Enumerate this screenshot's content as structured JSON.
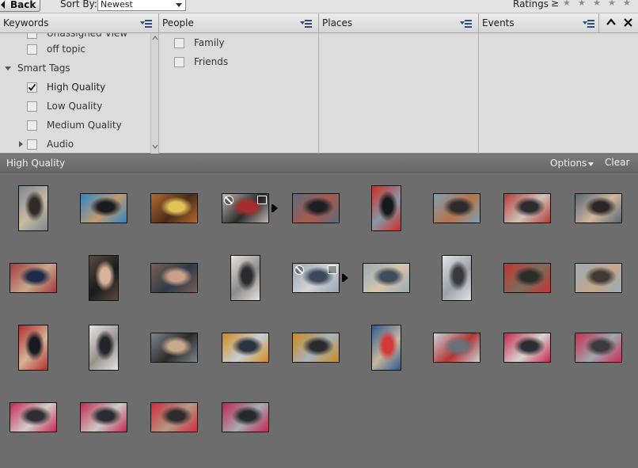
{
  "toolbar": {
    "back_label": "Back",
    "sort_label": "Sort By:",
    "sort_value": "Newest",
    "ratings_label": "Ratings",
    "ratings_compare": "≥",
    "stars": [
      "★",
      "★",
      "★",
      "★",
      "★"
    ]
  },
  "columns": {
    "keywords": "Keywords",
    "people": "People",
    "places": "Places",
    "events": "Events"
  },
  "keywords_list": [
    {
      "label": "Unassigned View",
      "checked": false,
      "clipped": true
    },
    {
      "label": "off topic",
      "checked": false
    },
    {
      "label": "Smart Tags",
      "is_group": true,
      "expanded": true
    },
    {
      "label": "High Quality",
      "checked": true
    },
    {
      "label": "Low Quality",
      "checked": false
    },
    {
      "label": "Medium Quality",
      "checked": false
    },
    {
      "label": "Audio",
      "checked": false,
      "collapsed_group": true
    }
  ],
  "people_list": [
    {
      "label": "Family",
      "checked": false
    },
    {
      "label": "Friends",
      "checked": false
    }
  ],
  "filter_bar": {
    "title": "High Quality",
    "options_label": "Options",
    "clear_label": "Clear"
  },
  "thumbnails": [
    {
      "scene": "man-with-phone-street",
      "orient": "portrait",
      "palette": [
        "#7b8792",
        "#2e2a28",
        "#c9b9a2"
      ]
    },
    {
      "scene": "blue-awning-shop",
      "orient": "landscape",
      "palette": [
        "#2f86c9",
        "#1b1b22",
        "#c29a6b"
      ]
    },
    {
      "scene": "candy-shop-window",
      "orient": "landscape",
      "palette": [
        "#b46a2c",
        "#e3c15a",
        "#4a2a1a"
      ]
    },
    {
      "scene": "shop-window-stack",
      "orient": "landscape",
      "palette": [
        "#c0b6ac",
        "#a52d2d",
        "#2b2b2b"
      ],
      "stacked": true,
      "rejected": true,
      "edited": true
    },
    {
      "scene": "crowd-street",
      "orient": "landscape",
      "palette": [
        "#596b7c",
        "#1d1f24",
        "#a85a4d"
      ]
    },
    {
      "scene": "man-red-jacket",
      "orient": "portrait",
      "palette": [
        "#cf2b2b",
        "#16181c",
        "#8a99a3"
      ]
    },
    {
      "scene": "woman-beanie-street",
      "orient": "landscape",
      "palette": [
        "#7c9fb5",
        "#2b2a2c",
        "#b7744a"
      ]
    },
    {
      "scene": "crowd-red-bus",
      "orient": "landscape",
      "palette": [
        "#b73939",
        "#2c2c2f",
        "#cfc4b8"
      ]
    },
    {
      "scene": "woman-scarf-crowd",
      "orient": "landscape",
      "palette": [
        "#556677",
        "#2c2727",
        "#d3b79c"
      ]
    },
    {
      "scene": "crowd-bokeh",
      "orient": "landscape",
      "palette": [
        "#a23a3a",
        "#1c2b4a",
        "#c9a98c"
      ]
    },
    {
      "scene": "woman-phone-portrait",
      "orient": "portrait",
      "palette": [
        "#5a4a3e",
        "#d8b49a",
        "#1b1b1b"
      ]
    },
    {
      "scene": "woman-red-hair",
      "orient": "landscape",
      "palette": [
        "#7b5f52",
        "#c9a18a",
        "#2d3a4a"
      ]
    },
    {
      "scene": "man-reading-phone",
      "orient": "portrait",
      "palette": [
        "#e7e2de",
        "#2b2b2f",
        "#8c8c8c"
      ]
    },
    {
      "scene": "two-panel-stack",
      "orient": "landscape",
      "palette": [
        "#93a6b7",
        "#3a4a5c",
        "#d4d4d4"
      ],
      "stacked": true,
      "rejected": true,
      "edited": true
    },
    {
      "scene": "woman-blonde-pair",
      "orient": "landscape",
      "palette": [
        "#95a9bb",
        "#3f4c5a",
        "#d9c6aa"
      ]
    },
    {
      "scene": "man-grey-hoodie",
      "orient": "portrait",
      "palette": [
        "#dfe4e8",
        "#3a3a3e",
        "#9aa3aa"
      ]
    },
    {
      "scene": "man-beanie-red-bus",
      "orient": "landscape",
      "palette": [
        "#c83232",
        "#2b2b28",
        "#7b6e5c"
      ]
    },
    {
      "scene": "woman-blonde-street",
      "orient": "landscape",
      "palette": [
        "#98acba",
        "#3e3a36",
        "#c6a78a"
      ]
    },
    {
      "scene": "man-glasses-red",
      "orient": "portrait",
      "palette": [
        "#b22d2d",
        "#19181c",
        "#d6b39a"
      ]
    },
    {
      "scene": "man-phone-crowd",
      "orient": "portrait",
      "palette": [
        "#e6e6e6",
        "#23252a",
        "#96918a"
      ]
    },
    {
      "scene": "man-bald-crowd",
      "orient": "landscape",
      "palette": [
        "#7c8590",
        "#c8a98c",
        "#2c2a27"
      ]
    },
    {
      "scene": "man-orange-jacket",
      "orient": "landscape",
      "palette": [
        "#d28a1a",
        "#2b3340",
        "#c9d0d6"
      ]
    },
    {
      "scene": "woman-yellow-coat",
      "orient": "landscape",
      "palette": [
        "#c98a1a",
        "#2a2a2e",
        "#a9b3bc"
      ]
    },
    {
      "scene": "street-red-car",
      "orient": "portrait",
      "palette": [
        "#2d5a8c",
        "#d23a3a",
        "#c7b6a0"
      ]
    },
    {
      "scene": "long-street-walkers",
      "orient": "landscape",
      "palette": [
        "#cbd1d6",
        "#6b6f76",
        "#b33535"
      ]
    },
    {
      "scene": "red-hoodie-pair",
      "orient": "landscape",
      "palette": [
        "#c7264f",
        "#2a2d33",
        "#d9d4cf"
      ]
    },
    {
      "scene": "red-hoodie-walk",
      "orient": "landscape",
      "palette": [
        "#c72a55",
        "#3b3a3c",
        "#a2a7ad"
      ]
    },
    {
      "scene": "red-hoodie-front",
      "orient": "landscape",
      "palette": [
        "#c92554",
        "#2e2f33",
        "#d3cfcb"
      ]
    },
    {
      "scene": "red-hoodie-crowd",
      "orient": "landscape",
      "palette": [
        "#bf2a50",
        "#2b2c31",
        "#cfcac5"
      ]
    },
    {
      "scene": "red-hoodie-bus",
      "orient": "landscape",
      "palette": [
        "#d12b3b",
        "#2f2c2d",
        "#b69a85"
      ]
    },
    {
      "scene": "red-hoodie-duo",
      "orient": "landscape",
      "palette": [
        "#c2244f",
        "#262a30",
        "#a7adb2"
      ]
    }
  ]
}
